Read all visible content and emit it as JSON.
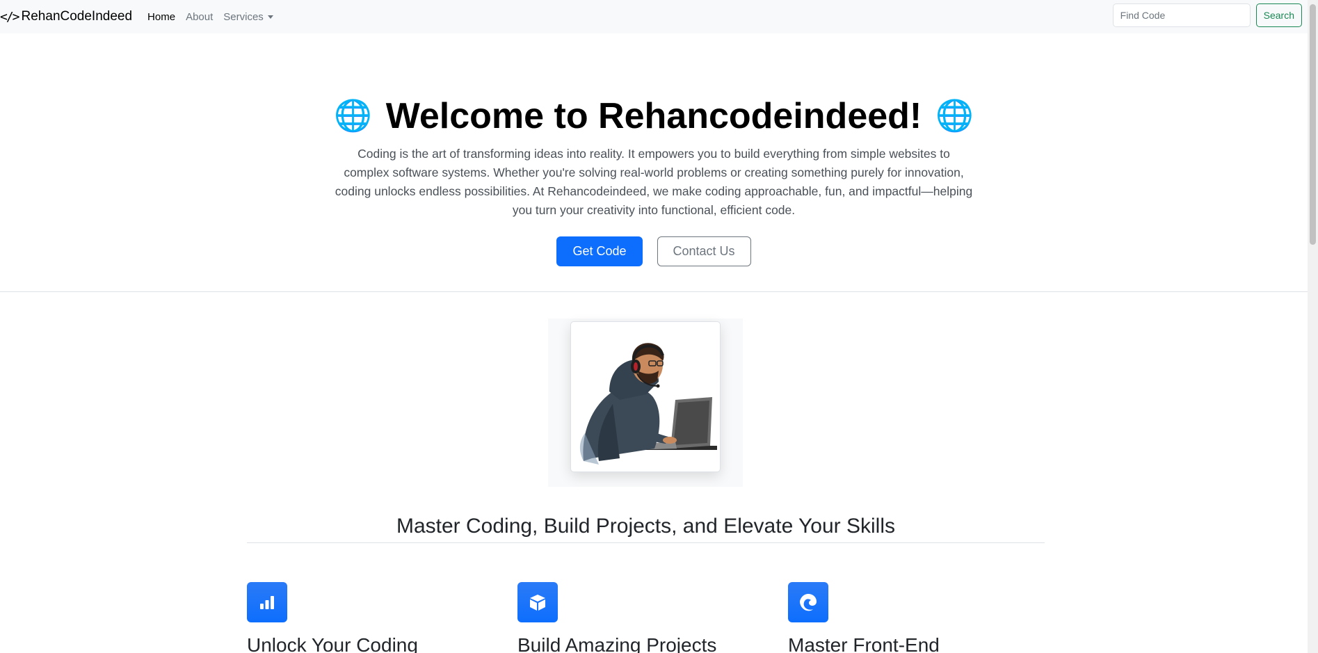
{
  "navbar": {
    "brand_icon": "</>",
    "brand": "RehanCodeIndeed",
    "links": [
      {
        "label": "Home",
        "active": true
      },
      {
        "label": "About",
        "active": false
      },
      {
        "label": "Services",
        "active": false,
        "dropdown": true
      }
    ],
    "search_placeholder": "Find Code",
    "search_value": "",
    "search_button": "Search"
  },
  "hero": {
    "icon_left": "🌐",
    "title": "Welcome to Rehancodeindeed!",
    "icon_right": "🌐",
    "lead": "Coding is the art of transforming ideas into reality. It empowers you to build everything from simple websites to complex software systems. Whether you're solving real-world problems or creating something purely for innovation, coding unlocks endless possibilities. At Rehancodeindeed, we make coding approachable, fun, and impactful—helping you turn your creativity into functional, efficient code.",
    "primary_button": "Get Code",
    "secondary_button": "Contact Us"
  },
  "image": {
    "alt_icon": "developer-illustration"
  },
  "section": {
    "heading": "Master Coding, Build Projects, and Elevate Your Skills"
  },
  "features": [
    {
      "icon": "bar-chart-icon",
      "title": "Unlock Your Coding"
    },
    {
      "icon": "box-icon",
      "title": "Build Amazing Projects"
    },
    {
      "icon": "edge-browser-icon",
      "title": "Master Front-End"
    }
  ],
  "colors": {
    "primary": "#0d6efd",
    "success": "#198754",
    "navbar_bg": "#f8f9fa"
  }
}
